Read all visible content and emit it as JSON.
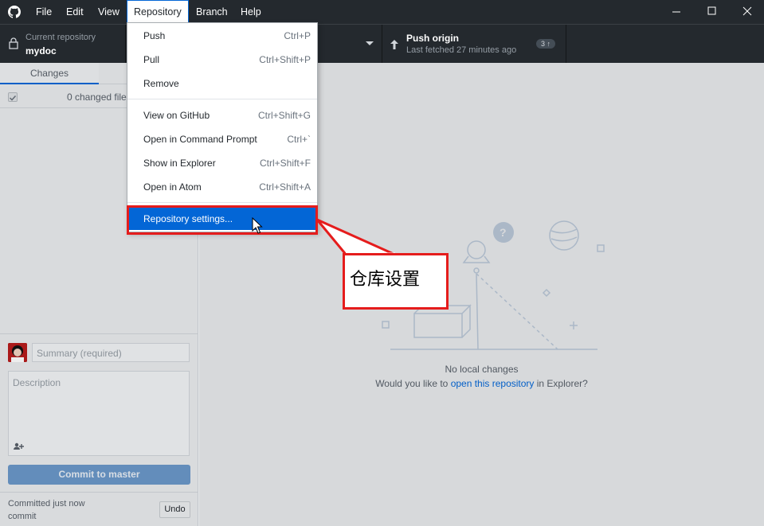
{
  "titlebar": {
    "menus": [
      "File",
      "Edit",
      "View",
      "Repository",
      "Branch",
      "Help"
    ]
  },
  "toolbar": {
    "current_repo_label": "Current repository",
    "current_repo_value": "mydoc",
    "push_label": "Push origin",
    "push_sub": "Last fetched 27 minutes ago",
    "push_badge": "3 ↑"
  },
  "sidebar": {
    "tab_changes": "Changes",
    "changed_files": "0 changed files",
    "summary_placeholder": "Summary (required)",
    "description_placeholder": "Description",
    "commit_button": "Commit to master",
    "undo_line1": "Committed just now",
    "undo_line2": "commit",
    "undo_button": "Undo"
  },
  "main": {
    "no_changes": "No local changes",
    "prompt_before": "Would you like to ",
    "prompt_link": "open this repository",
    "prompt_after": " in Explorer?"
  },
  "repository_menu": {
    "items": [
      {
        "label": "Push",
        "shortcut": "Ctrl+P"
      },
      {
        "label": "Pull",
        "shortcut": "Ctrl+Shift+P"
      },
      {
        "label": "Remove",
        "shortcut": ""
      },
      {
        "label": "View on GitHub",
        "shortcut": "Ctrl+Shift+G"
      },
      {
        "label": "Open in Command Prompt",
        "shortcut": "Ctrl+`"
      },
      {
        "label": "Show in Explorer",
        "shortcut": "Ctrl+Shift+F"
      },
      {
        "label": "Open in Atom",
        "shortcut": "Ctrl+Shift+A"
      },
      {
        "label": "Repository settings...",
        "shortcut": ""
      }
    ]
  },
  "annotation": {
    "callout_text": "仓库设置",
    "color": "#e51c1c"
  },
  "colors": {
    "accent": "#0366d6",
    "titlebar": "#24292e"
  }
}
